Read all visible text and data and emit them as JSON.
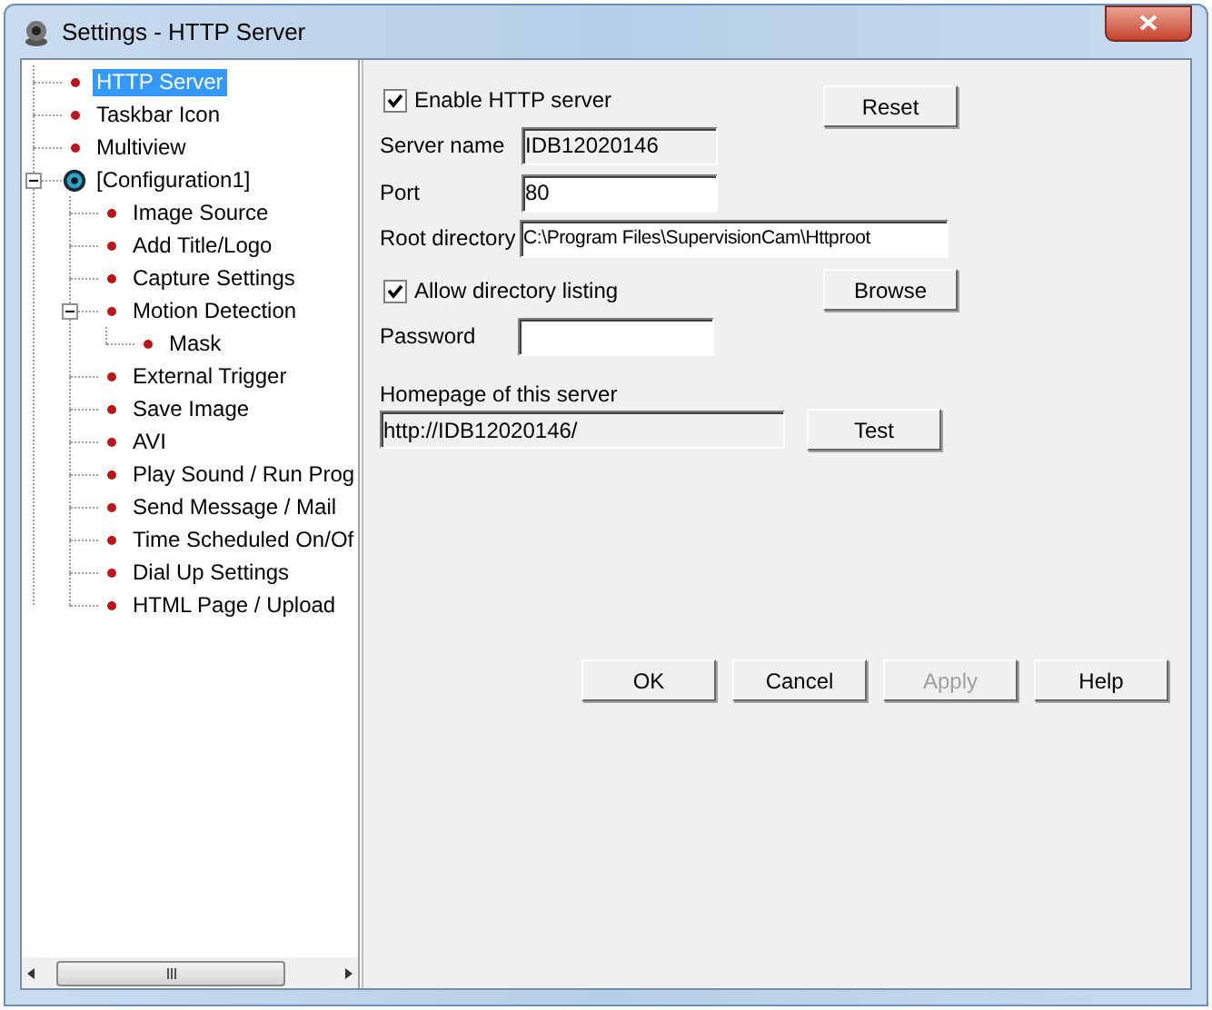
{
  "window": {
    "title": "Settings - HTTP Server"
  },
  "tree": [
    {
      "label": "HTTP Server",
      "kind": "item",
      "selected": true
    },
    {
      "label": "Taskbar Icon",
      "kind": "item",
      "selected": false
    },
    {
      "label": "Multiview",
      "kind": "item",
      "selected": false
    },
    {
      "label": "[Configuration1]",
      "kind": "config",
      "selected": false,
      "expanded": true,
      "children": [
        {
          "label": "Image Source",
          "kind": "item",
          "selected": false
        },
        {
          "label": "Add Title/Logo",
          "kind": "item",
          "selected": false
        },
        {
          "label": "Capture Settings",
          "kind": "item",
          "selected": false
        },
        {
          "label": "Motion Detection",
          "kind": "item",
          "selected": false,
          "expanded": true,
          "children": [
            {
              "label": "Mask",
              "kind": "item",
              "selected": false
            }
          ]
        },
        {
          "label": "External Trigger",
          "kind": "item",
          "selected": false
        },
        {
          "label": "Save Image",
          "kind": "item",
          "selected": false
        },
        {
          "label": "AVI",
          "kind": "item",
          "selected": false
        },
        {
          "label": "Play Sound / Run Prog",
          "kind": "item",
          "selected": false
        },
        {
          "label": "Send Message / Mail",
          "kind": "item",
          "selected": false
        },
        {
          "label": "Time Scheduled On/Of",
          "kind": "item",
          "selected": false
        },
        {
          "label": "Dial Up Settings",
          "kind": "item",
          "selected": false
        },
        {
          "label": "HTML Page / Upload",
          "kind": "item",
          "selected": false
        }
      ]
    }
  ],
  "form": {
    "enable_http": {
      "label": "Enable HTTP server",
      "checked": true
    },
    "reset_button": {
      "label": "Reset"
    },
    "server_name": {
      "label": "Server name",
      "value": "IDB12020146",
      "readonly": true
    },
    "port": {
      "label": "Port",
      "value": "80",
      "readonly": false
    },
    "root_directory": {
      "label": "Root directory",
      "value": "C:\\Program Files\\SupervisionCam\\Httproot",
      "readonly": false
    },
    "allow_listing": {
      "label": "Allow directory listing",
      "checked": true
    },
    "browse_button": {
      "label": "Browse"
    },
    "password": {
      "label": "Password",
      "readonly": false
    },
    "homepage": {
      "label": "Homepage of this server",
      "value": "http://IDB12020146/",
      "readonly": true
    },
    "test_button": {
      "label": "Test"
    }
  },
  "buttons": [
    {
      "label": "OK",
      "disabled": false
    },
    {
      "label": "Cancel",
      "disabled": false
    },
    {
      "label": "Apply",
      "disabled": true
    },
    {
      "label": "Help",
      "disabled": false
    }
  ]
}
